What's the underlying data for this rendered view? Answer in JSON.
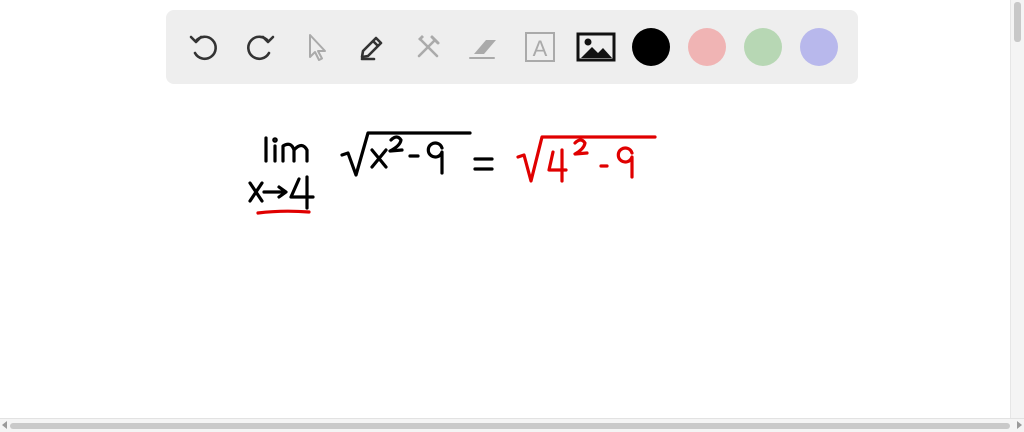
{
  "toolbar": {
    "tools": [
      {
        "name": "undo-icon"
      },
      {
        "name": "redo-icon"
      },
      {
        "name": "select-pointer-icon"
      },
      {
        "name": "pencil-icon"
      },
      {
        "name": "tools-icon"
      },
      {
        "name": "eraser-icon"
      },
      {
        "name": "text-icon",
        "label": "A"
      },
      {
        "name": "image-icon"
      }
    ],
    "colors": [
      {
        "name": "color-black",
        "hex": "#000000"
      },
      {
        "name": "color-red",
        "hex": "#f0b4b4"
      },
      {
        "name": "color-green",
        "hex": "#b7d7b4"
      },
      {
        "name": "color-blue",
        "hex": "#b8b8ec"
      }
    ]
  },
  "canvas": {
    "handwriting_left": "lim x→4 √(x² − 9)",
    "handwriting_equals": "=",
    "handwriting_right": "√(4² − 9)",
    "ink_black": "#000000",
    "ink_red": "#e00000"
  }
}
